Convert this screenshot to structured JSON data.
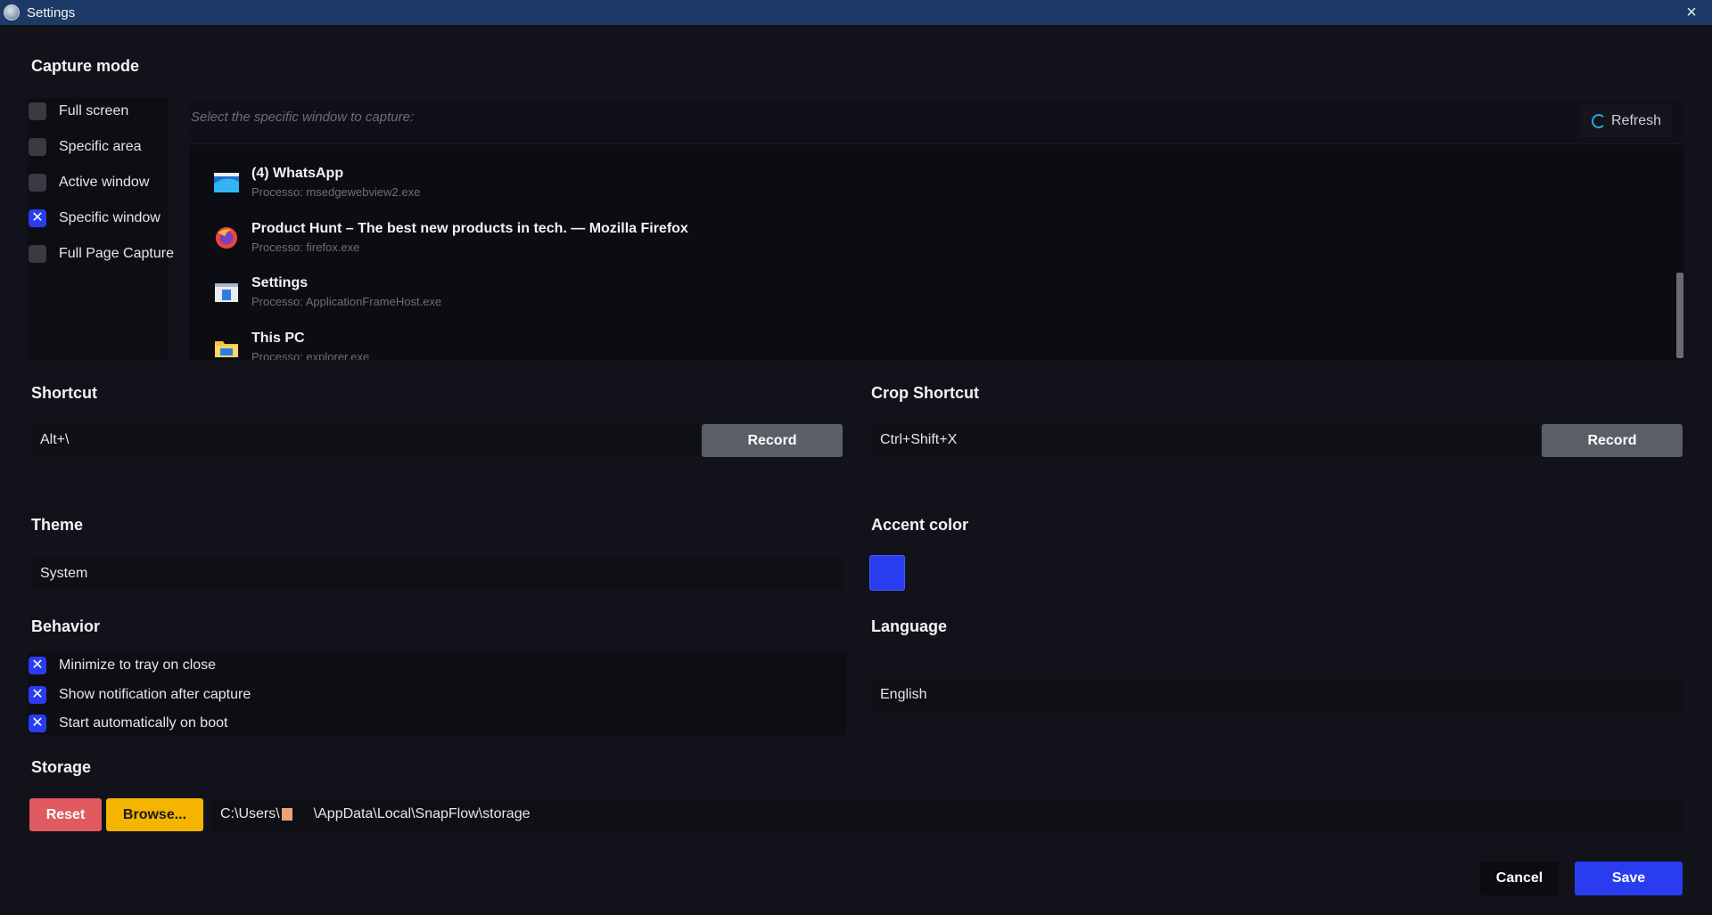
{
  "window": {
    "title": "Settings",
    "close_icon": "×"
  },
  "capture_mode": {
    "heading": "Capture mode",
    "options": [
      {
        "label": "Full screen",
        "checked": false
      },
      {
        "label": "Specific area",
        "checked": false
      },
      {
        "label": "Active window",
        "checked": false
      },
      {
        "label": "Specific window",
        "checked": true
      },
      {
        "label": "Full Page Capture",
        "checked": false
      }
    ],
    "window_picker": {
      "placeholder": "Select the specific window to capture:",
      "refresh_label": "Refresh",
      "windows": [
        {
          "title": "(4) WhatsApp",
          "process": "Processo: msedgewebview2.exe",
          "icon": "edge-webview-icon"
        },
        {
          "title": "Product Hunt – The best new products in tech. — Mozilla Firefox",
          "process": "Processo: firefox.exe",
          "icon": "firefox-icon"
        },
        {
          "title": "Settings",
          "process": "Processo: ApplicationFrameHost.exe",
          "icon": "app-frame-icon"
        },
        {
          "title": "This PC",
          "process": "Processo: explorer.exe",
          "icon": "folder-icon"
        }
      ]
    }
  },
  "shortcut": {
    "heading": "Shortcut",
    "value": "Alt+\\",
    "record_label": "Record"
  },
  "crop_shortcut": {
    "heading": "Crop Shortcut",
    "value": "Ctrl+Shift+X",
    "record_label": "Record"
  },
  "theme": {
    "heading": "Theme",
    "value": "System"
  },
  "accent_color": {
    "heading": "Accent color",
    "color": "#2a3cf0"
  },
  "behavior": {
    "heading": "Behavior",
    "options": [
      {
        "label": "Minimize to tray on close",
        "checked": true
      },
      {
        "label": "Show notification after capture",
        "checked": true
      },
      {
        "label": "Start automatically on boot",
        "checked": true
      }
    ]
  },
  "language": {
    "heading": "Language",
    "value": "English"
  },
  "storage": {
    "heading": "Storage",
    "reset_label": "Reset",
    "browse_label": "Browse...",
    "path_prefix": "C:\\Users\\",
    "path_suffix": "\\AppData\\Local\\SnapFlow\\storage"
  },
  "footer": {
    "cancel_label": "Cancel",
    "save_label": "Save"
  },
  "colors": {
    "titlebar": "#1d3a66",
    "accent": "#2a3cf0",
    "reset": "#e05a5f",
    "browse": "#f4b400"
  }
}
